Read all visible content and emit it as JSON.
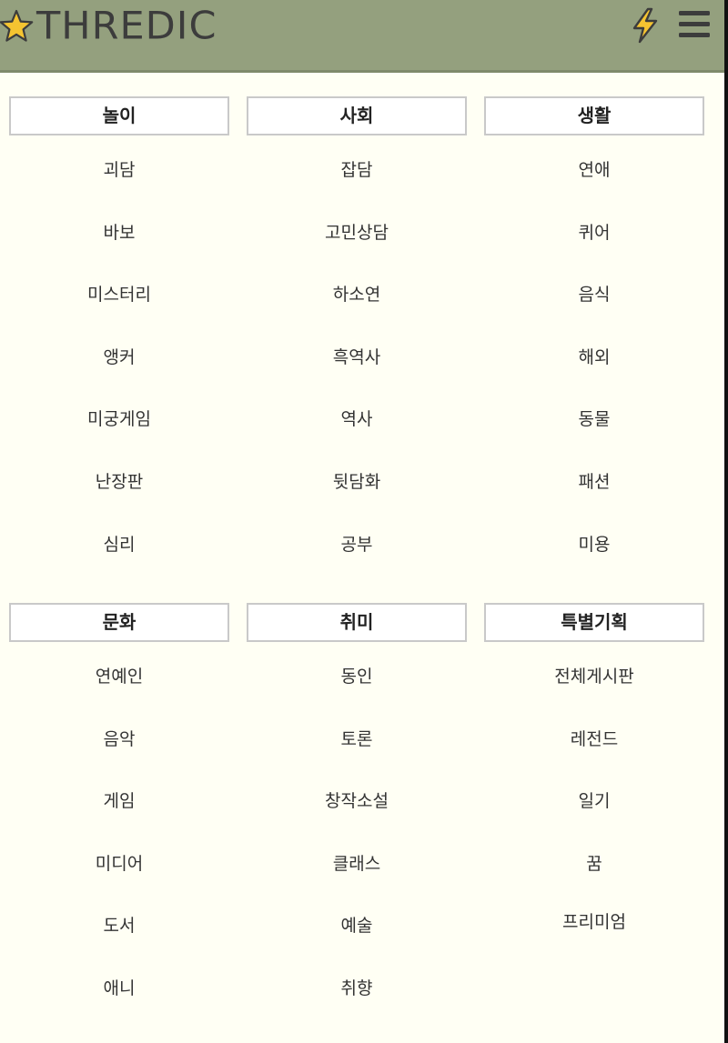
{
  "header": {
    "logo_text": "THREDIC",
    "logo_icon": "star-icon",
    "quick_icon": "lightning-icon",
    "menu_icon": "hamburger-menu-icon"
  },
  "colors": {
    "header_bg": "#94a07e",
    "page_bg": "#fffff4",
    "logo_star": "#f5c431",
    "bolt": "#f5c431"
  },
  "sections": [
    {
      "columns": [
        {
          "title": "놀이",
          "items": [
            "괴담",
            "바보",
            "미스터리",
            "앵커",
            "미궁게임",
            "난장판",
            "심리"
          ]
        },
        {
          "title": "사회",
          "items": [
            "잡담",
            "고민상담",
            "하소연",
            "흑역사",
            "역사",
            "뒷담화",
            "공부"
          ]
        },
        {
          "title": "생활",
          "items": [
            "연애",
            "퀴어",
            "음식",
            "해외",
            "동물",
            "패션",
            "미용"
          ]
        }
      ]
    },
    {
      "columns": [
        {
          "title": "문화",
          "items": [
            "연예인",
            "음악",
            "게임",
            "미디어",
            "도서",
            "애니"
          ]
        },
        {
          "title": "취미",
          "items": [
            "동인",
            "토론",
            "창작소설",
            "클래스",
            "예술",
            "취향"
          ]
        },
        {
          "title": "특별기획",
          "items": [
            "전체게시판",
            "레전드",
            "일기",
            "꿈",
            "프리미엄"
          ]
        }
      ]
    }
  ]
}
